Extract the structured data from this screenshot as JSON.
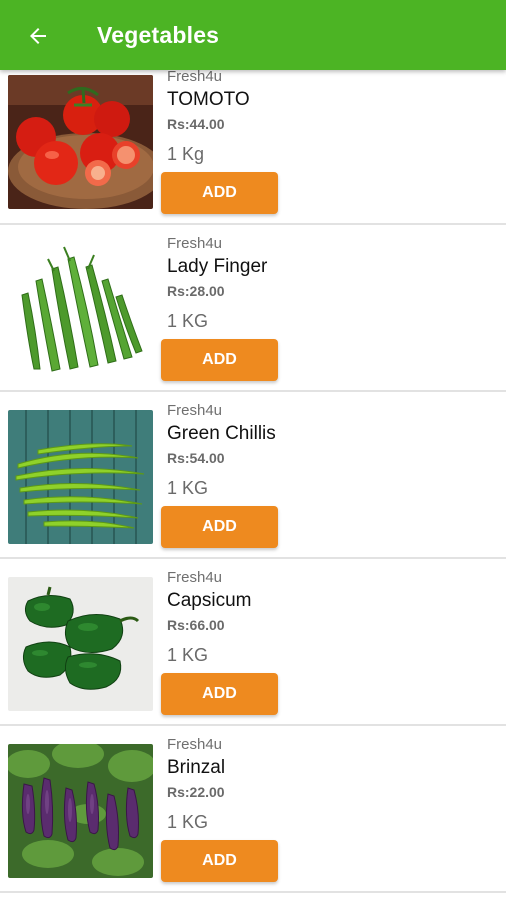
{
  "appbar": {
    "title": "Vegetables",
    "back_icon": "arrow-left-icon"
  },
  "colors": {
    "appbar": "#4cb424",
    "add_button": "#ee8a1f"
  },
  "products": [
    {
      "brand": "Fresh4u",
      "name": "TOMOTO",
      "price": "Rs:44.00",
      "unit": "1 Kg",
      "button": "ADD",
      "image": "tomato-image"
    },
    {
      "brand": "Fresh4u",
      "name": "Lady Finger",
      "price": "Rs:28.00",
      "unit": "1 KG",
      "button": "ADD",
      "image": "okra-image"
    },
    {
      "brand": "Fresh4u",
      "name": "Green Chillis",
      "price": "Rs:54.00",
      "unit": "1 KG",
      "button": "ADD",
      "image": "green-chilli-image"
    },
    {
      "brand": "Fresh4u",
      "name": "Capsicum",
      "price": "Rs:66.00",
      "unit": "1 KG",
      "button": "ADD",
      "image": "capsicum-image"
    },
    {
      "brand": "Fresh4u",
      "name": "Brinzal",
      "price": "Rs:22.00",
      "unit": "1 KG",
      "button": "ADD",
      "image": "brinjal-image"
    }
  ]
}
